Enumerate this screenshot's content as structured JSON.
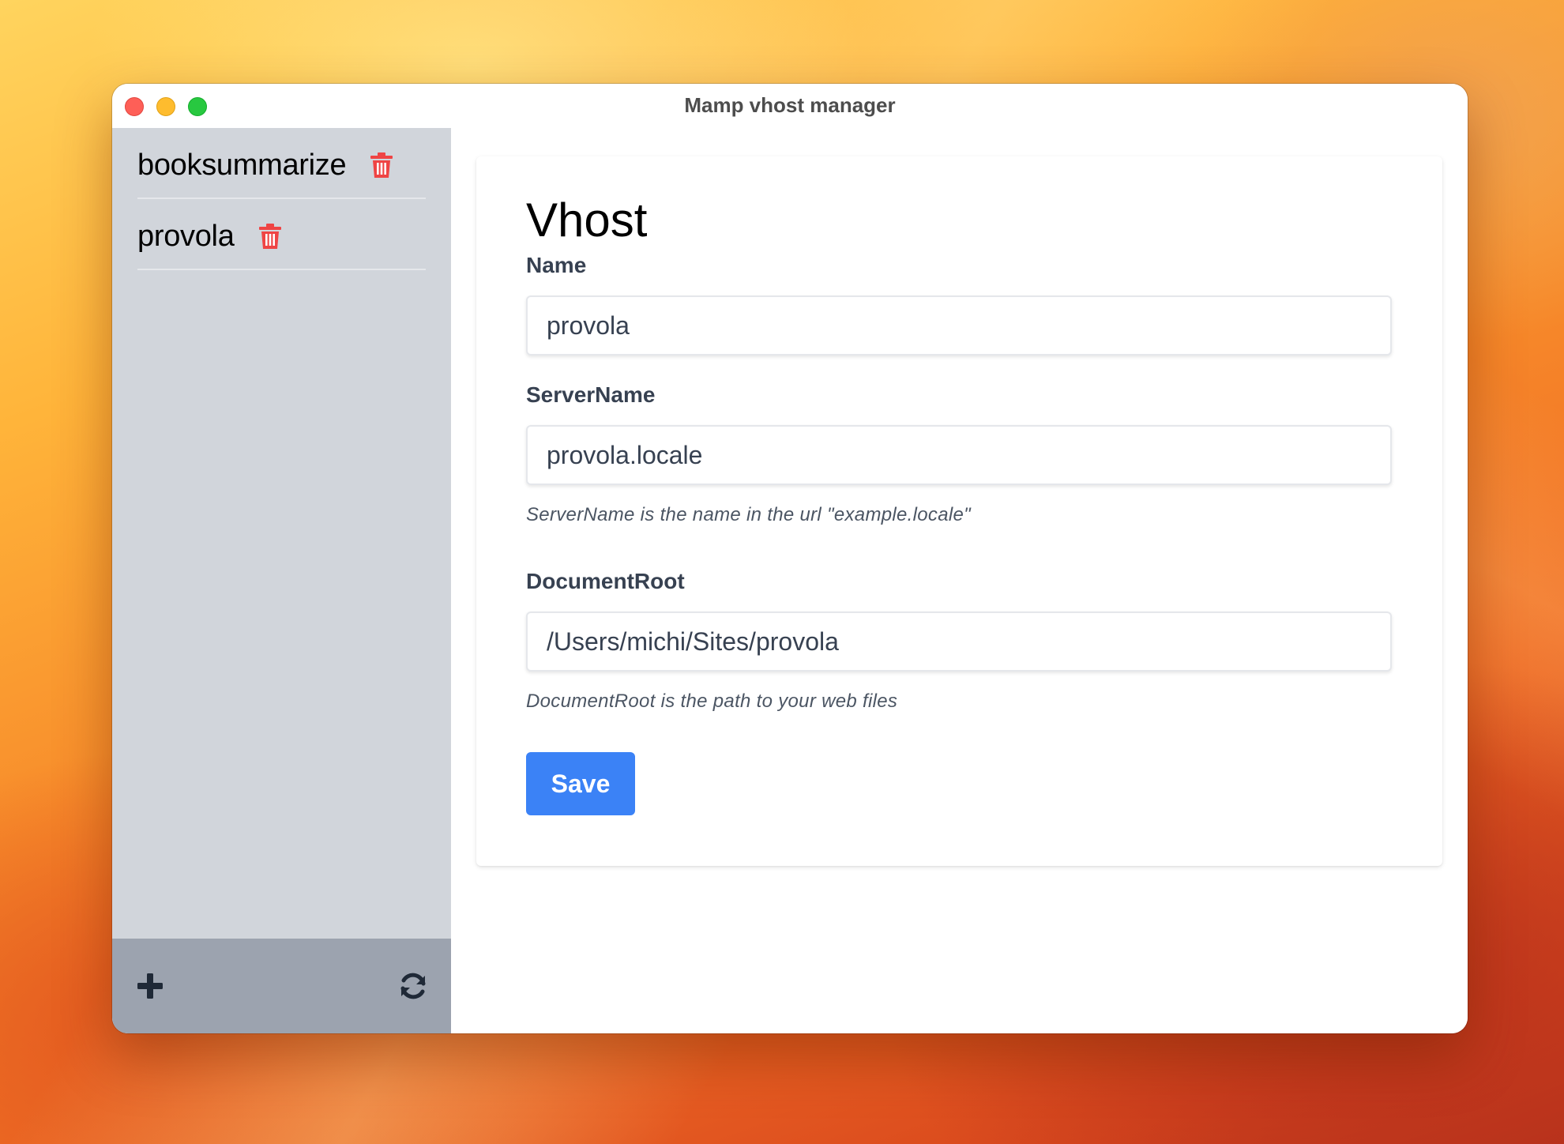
{
  "window": {
    "title": "Mamp vhost manager"
  },
  "sidebar": {
    "items": [
      {
        "label": "booksummarize",
        "delete_icon": "trash-icon"
      },
      {
        "label": "provola",
        "delete_icon": "trash-icon"
      }
    ],
    "footer": {
      "add_icon": "plus-icon",
      "refresh_icon": "refresh-icon"
    }
  },
  "form": {
    "title": "Vhost",
    "name": {
      "label": "Name",
      "value": "provola"
    },
    "server_name": {
      "label": "ServerName",
      "value": "provola.locale",
      "help": "ServerName is the name in the url \"example.locale\""
    },
    "document_root": {
      "label": "DocumentRoot",
      "value": "/Users/michi/Sites/provola",
      "help": "DocumentRoot is the path to your web files"
    },
    "save_label": "Save"
  },
  "colors": {
    "accent": "#3b82f6",
    "danger": "#ef4444",
    "sidebar_bg": "#d1d5db",
    "sidebar_footer_bg": "#9ca3af"
  }
}
